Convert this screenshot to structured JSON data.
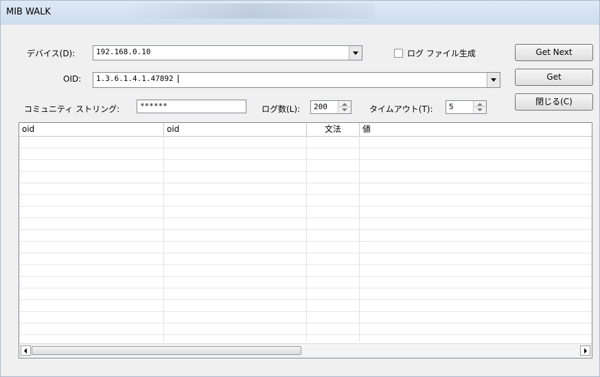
{
  "window": {
    "title": "MIB WALK"
  },
  "device": {
    "label": "デバイス(D):",
    "value": "192.168.0.10"
  },
  "log_file": {
    "label": "ログ ファイル生成",
    "checked": false
  },
  "oid": {
    "label": "OID:",
    "value": "1.3.6.1.4.1.47892"
  },
  "community": {
    "label": "コミュニティ ストリング:",
    "value": "******"
  },
  "log_count": {
    "label": "ログ数(L):",
    "value": "200"
  },
  "timeout": {
    "label": "タイムアウト(T):",
    "value": "5"
  },
  "buttons": {
    "get_next": "Get Next",
    "get": "Get",
    "close": "閉じる(C)"
  },
  "table": {
    "columns": [
      "oid",
      "oid",
      "文法",
      "値"
    ],
    "rows": []
  }
}
